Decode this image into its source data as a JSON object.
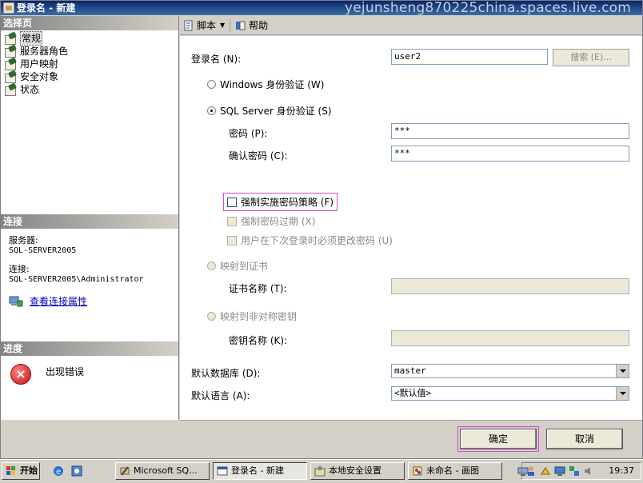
{
  "window": {
    "title": "登录名 - 新建",
    "watermark": "yejunsheng870225china.spaces.live.com"
  },
  "left_panel": {
    "select_page_header": "选择页",
    "pages": [
      {
        "label": "常规",
        "selected": true
      },
      {
        "label": "服务器角色",
        "selected": false
      },
      {
        "label": "用户映射",
        "selected": false
      },
      {
        "label": "安全对象",
        "selected": false
      },
      {
        "label": "状态",
        "selected": false
      }
    ],
    "connection_header": "连接",
    "server_label": "服务器:",
    "server_value": "SQL-SERVER2005",
    "connection_label": "连接:",
    "connection_value": "SQL-SERVER2005\\Administrator",
    "view_connection_link": "查看连接属性",
    "progress_header": "进度",
    "progress_status": "出现错误"
  },
  "toolbar": {
    "script_label": "脚本",
    "help_label": "帮助"
  },
  "form": {
    "login_name_label": "登录名 (N):",
    "login_name_value": "user2",
    "search_button": "搜索 (E)...",
    "windows_auth_label": "Windows 身份验证 (W)",
    "sql_auth_label": "SQL Server 身份验证 (S)",
    "password_label": "密码 (P):",
    "password_value": "***",
    "confirm_password_label": "确认密码 (C):",
    "confirm_password_value": "***",
    "enforce_policy_label": "强制实施密码策略 (F)",
    "enforce_expiration_label": "强制密码过期 (X)",
    "must_change_label": "用户在下次登录时必须更改密码 (U)",
    "map_cert_label": "映射到证书",
    "cert_name_label": "证书名称 (T):",
    "map_asym_label": "映射到非对称密钥",
    "key_name_label": "密钥名称 (K):",
    "default_db_label": "默认数据库 (D):",
    "default_db_value": "master",
    "default_lang_label": "默认语言 (A):",
    "default_lang_value": "<默认值>"
  },
  "buttons": {
    "ok": "确定",
    "cancel": "取消"
  },
  "taskbar": {
    "start": "开始",
    "items": [
      {
        "label": "Microsoft SQ..."
      },
      {
        "label": "登录名 - 新建"
      },
      {
        "label": "本地安全设置"
      },
      {
        "label": "未命名 - 画图"
      }
    ],
    "clock": "19:37"
  }
}
